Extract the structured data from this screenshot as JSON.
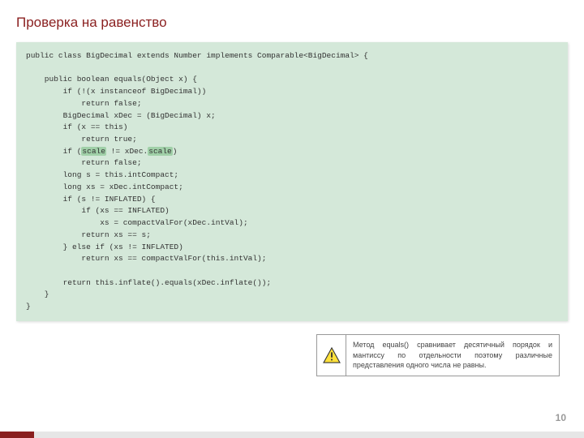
{
  "title": "Проверка на равенство",
  "code": {
    "l1": "public class BigDecimal extends Number implements Comparable<BigDecimal> {",
    "l2": "",
    "l3": "    public boolean equals(Object x) {",
    "l4": "        if (!(x instanceof BigDecimal))",
    "l5": "            return false;",
    "l6": "        BigDecimal xDec = (BigDecimal) x;",
    "l7": "        if (x == this)",
    "l8": "            return true;",
    "l9a": "        if (",
    "l9b": "scale",
    "l9c": " != xDec.",
    "l9d": "scale",
    "l9e": ")",
    "l10": "            return false;",
    "l11": "        long s = this.intCompact;",
    "l12": "        long xs = xDec.intCompact;",
    "l13": "        if (s != INFLATED) {",
    "l14": "            if (xs == INFLATED)",
    "l15": "                xs = compactValFor(xDec.intVal);",
    "l16": "            return xs == s;",
    "l17": "        } else if (xs != INFLATED)",
    "l18": "            return xs == compactValFor(this.intVal);",
    "l19": "",
    "l20": "        return this.inflate().equals(xDec.inflate());",
    "l21": "    }",
    "l22": "}"
  },
  "note": "Метод equals() сравнивает десятичный порядок и мантиссу по отдельности поэтому различные представления одного числа не равны.",
  "page": "10"
}
